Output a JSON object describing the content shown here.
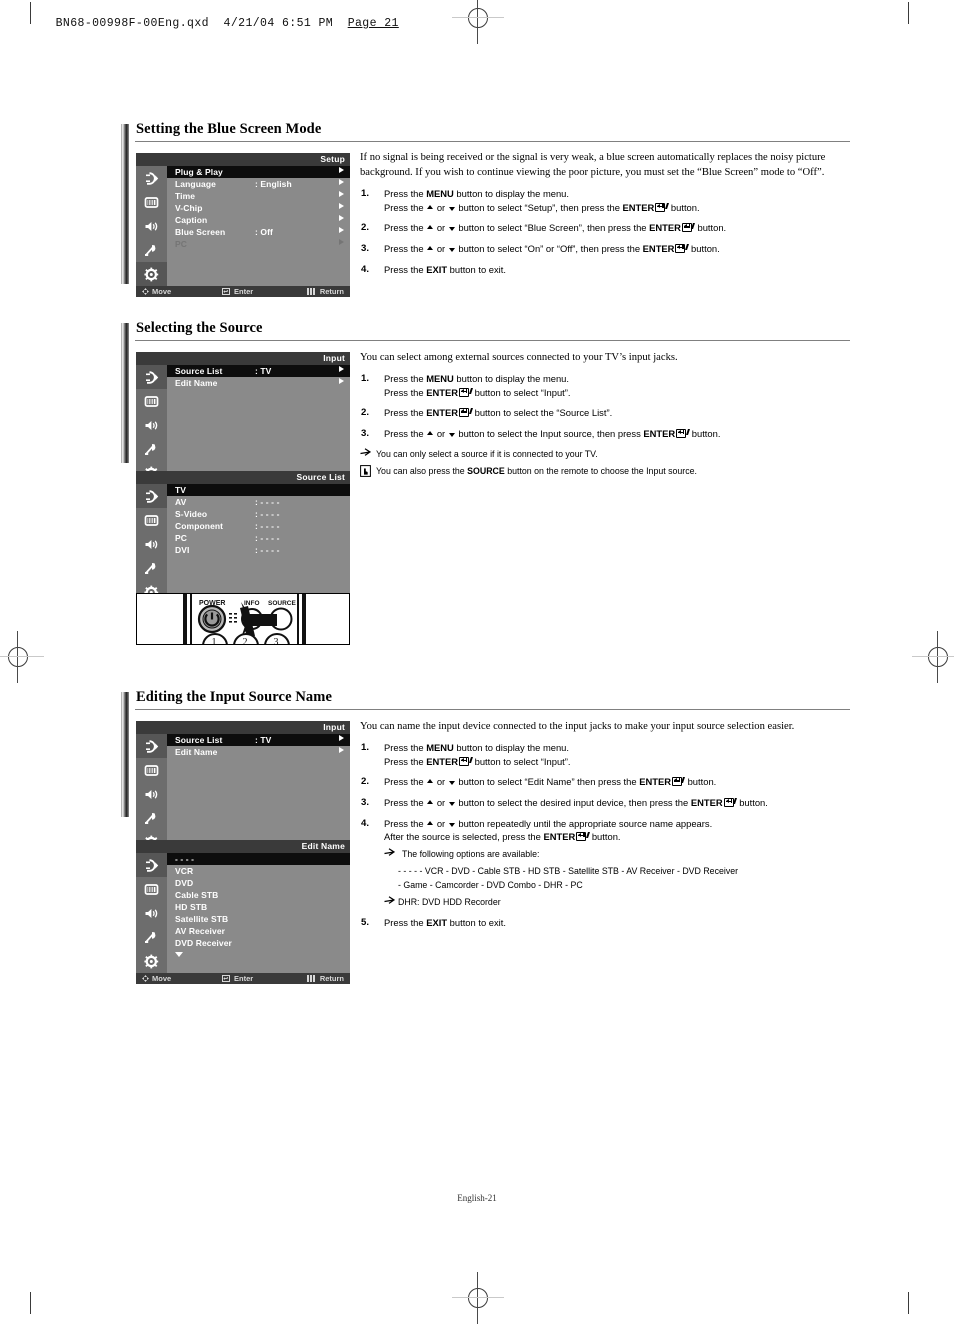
{
  "page_header": {
    "filename": "BN68-00998F-00Eng.qxd",
    "date": "4/21/04",
    "time": "6:51 PM",
    "page_label": "Page 21"
  },
  "footer": {
    "text": "English-21"
  },
  "osd_common": {
    "move_label": "Move",
    "enter_label": "Enter",
    "return_label": "Return",
    "icons": [
      "input-source-icon",
      "picture-icon",
      "sound-icon",
      "channel-antenna-icon",
      "setup-gear-icon"
    ]
  },
  "sections": [
    {
      "id": "blue-screen",
      "title": "Setting the Blue Screen Mode",
      "osd": {
        "header": "Setup",
        "active_icon_index": 4,
        "rows": [
          {
            "name": "Plug & Play",
            "value": "",
            "selected": true,
            "dim": false,
            "arrow": true
          },
          {
            "name": "Language",
            "value": ": English",
            "selected": false,
            "dim": false,
            "arrow": true
          },
          {
            "name": "Time",
            "value": "",
            "selected": false,
            "dim": false,
            "arrow": true
          },
          {
            "name": "V-Chip",
            "value": "",
            "selected": false,
            "dim": false,
            "arrow": true
          },
          {
            "name": "Caption",
            "value": "",
            "selected": false,
            "dim": false,
            "arrow": true
          },
          {
            "name": "Blue Screen",
            "value": ": Off",
            "selected": false,
            "dim": false,
            "arrow": true
          },
          {
            "name": "PC",
            "value": "",
            "selected": false,
            "dim": true,
            "arrow": true
          }
        ],
        "blank_rows": 0,
        "show_more_arrow": false
      },
      "intro": "If no signal is being received or the signal is very weak, a blue screen automatically replaces the noisy picture background. If you wish to continue viewing the poor picture, you must set the “Blue Screen” mode to “Off”.",
      "steps": [
        {
          "num": "1.",
          "lines": [
            {
              "parts": [
                {
                  "t": "Press the "
                },
                {
                  "t": "MENU",
                  "b": true
                },
                {
                  "t": " button to display the menu."
                }
              ]
            },
            {
              "parts": [
                {
                  "t": "Press the "
                },
                {
                  "icon": "up-arrow"
                },
                {
                  "t": " or "
                },
                {
                  "icon": "down-arrow"
                },
                {
                  "t": " button to select “Setup”, then press the "
                },
                {
                  "t": "ENTER",
                  "b": true
                },
                {
                  "icon": "enter-key"
                },
                {
                  "t": " button."
                }
              ]
            }
          ]
        },
        {
          "num": "2.",
          "lines": [
            {
              "parts": [
                {
                  "t": "Press the "
                },
                {
                  "icon": "up-arrow"
                },
                {
                  "t": " or "
                },
                {
                  "icon": "down-arrow"
                },
                {
                  "t": " button to select “Blue Screen”, then press the "
                },
                {
                  "t": "ENTER",
                  "b": true
                },
                {
                  "icon": "enter-key"
                },
                {
                  "t": " button."
                }
              ]
            }
          ]
        },
        {
          "num": "3.",
          "lines": [
            {
              "parts": [
                {
                  "t": "Press the "
                },
                {
                  "icon": "up-arrow"
                },
                {
                  "t": " or "
                },
                {
                  "icon": "down-arrow"
                },
                {
                  "t": " button to select “On” or “Off”, then press the "
                },
                {
                  "t": "ENTER",
                  "b": true
                },
                {
                  "icon": "enter-key"
                },
                {
                  "t": " button."
                }
              ]
            }
          ]
        },
        {
          "num": "4.",
          "lines": [
            {
              "parts": [
                {
                  "t": "Press the "
                },
                {
                  "t": "EXIT",
                  "b": true
                },
                {
                  "t": " button to exit."
                }
              ]
            }
          ]
        }
      ],
      "notes": []
    },
    {
      "id": "selecting-source",
      "title": "Selecting the Source",
      "osd": {
        "header": "Input",
        "active_icon_index": 0,
        "rows": [
          {
            "name": "Source List",
            "value": ": TV",
            "selected": true,
            "dim": false,
            "arrow": true
          },
          {
            "name": "Edit Name",
            "value": "",
            "selected": false,
            "dim": false,
            "arrow": true
          }
        ],
        "blank_rows": 5,
        "show_more_arrow": false
      },
      "osd2": {
        "header": "Source List",
        "active_icon_index": 0,
        "rows": [
          {
            "name": "TV",
            "value": "",
            "selected": true,
            "dim": false,
            "arrow": false
          },
          {
            "name": "AV",
            "value": ": - - - -",
            "selected": false,
            "dim": false,
            "arrow": false
          },
          {
            "name": "S-Video",
            "value": ": - - - -",
            "selected": false,
            "dim": false,
            "arrow": false
          },
          {
            "name": "Component",
            "value": ": - - - -",
            "selected": false,
            "dim": false,
            "arrow": false
          },
          {
            "name": "PC",
            "value": ": - - - -",
            "selected": false,
            "dim": false,
            "arrow": false
          },
          {
            "name": "DVI",
            "value": ": - - - -",
            "selected": false,
            "dim": false,
            "arrow": false
          }
        ],
        "blank_rows": 1,
        "show_more_arrow": false
      },
      "remote": {
        "power_label": "POWER",
        "info_label": "INFO",
        "source_label": "SOURCE",
        "buttons": [
          "1",
          "2",
          "3"
        ]
      },
      "intro": "You can select among external sources connected to your TV’s input jacks.",
      "steps": [
        {
          "num": "1.",
          "lines": [
            {
              "parts": [
                {
                  "t": "Press the "
                },
                {
                  "t": "MENU",
                  "b": true
                },
                {
                  "t": " button to display the menu."
                }
              ]
            },
            {
              "parts": [
                {
                  "t": "Press the "
                },
                {
                  "t": "ENTER",
                  "b": true
                },
                {
                  "icon": "enter-key"
                },
                {
                  "t": " button to select “Input”."
                }
              ]
            }
          ]
        },
        {
          "num": "2.",
          "lines": [
            {
              "parts": [
                {
                  "t": "Press the "
                },
                {
                  "t": "ENTER",
                  "b": true
                },
                {
                  "icon": "enter-key"
                },
                {
                  "t": " button to select the “Source List”."
                }
              ]
            }
          ]
        },
        {
          "num": "3.",
          "lines": [
            {
              "parts": [
                {
                  "t": "Press the "
                },
                {
                  "icon": "up-arrow"
                },
                {
                  "t": " or "
                },
                {
                  "icon": "down-arrow"
                },
                {
                  "t": " button to select the Input source, then press "
                },
                {
                  "t": "ENTER",
                  "b": true
                },
                {
                  "icon": "enter-key"
                },
                {
                  "t": " button."
                }
              ]
            }
          ]
        }
      ],
      "notes": [
        {
          "glyph": "note-arrow-icon",
          "parts": [
            {
              "t": "You can only select a source if it is connected to your TV."
            }
          ]
        },
        {
          "glyph": "remote-hand-icon",
          "parts": [
            {
              "t": "You can also press the "
            },
            {
              "t": "SOURCE",
              "b": true
            },
            {
              "t": " button on the remote to choose the Input source."
            }
          ]
        }
      ]
    },
    {
      "id": "editing-input-source-name",
      "title": "Editing the Input Source Name",
      "osd": {
        "header": "Input",
        "active_icon_index": 0,
        "rows": [
          {
            "name": "Source List",
            "value": ": TV",
            "selected": true,
            "dim": false,
            "arrow": true
          },
          {
            "name": "Edit Name",
            "value": "",
            "selected": false,
            "dim": false,
            "arrow": true
          }
        ],
        "blank_rows": 5,
        "show_more_arrow": false
      },
      "osd2": {
        "header": "Edit Name",
        "active_icon_index": 0,
        "rows": [
          {
            "name": "- - - -",
            "value": "",
            "selected": true,
            "dim": false,
            "arrow": false
          },
          {
            "name": "VCR",
            "value": "",
            "selected": false,
            "dim": false,
            "arrow": false
          },
          {
            "name": "DVD",
            "value": "",
            "selected": false,
            "dim": false,
            "arrow": false
          },
          {
            "name": "Cable STB",
            "value": "",
            "selected": false,
            "dim": false,
            "arrow": false
          },
          {
            "name": "HD STB",
            "value": "",
            "selected": false,
            "dim": false,
            "arrow": false
          },
          {
            "name": "Satellite STB",
            "value": "",
            "selected": false,
            "dim": false,
            "arrow": false
          },
          {
            "name": "AV Receiver",
            "value": "",
            "selected": false,
            "dim": false,
            "arrow": false
          },
          {
            "name": "DVD Receiver",
            "value": "",
            "selected": false,
            "dim": false,
            "arrow": false
          }
        ],
        "blank_rows": 0,
        "show_more_arrow": true
      },
      "intro": "You can name the input device connected to the input jacks to make your input source selection easier.",
      "steps": [
        {
          "num": "1.",
          "lines": [
            {
              "parts": [
                {
                  "t": "Press the "
                },
                {
                  "t": "MENU",
                  "b": true
                },
                {
                  "t": " button to display the menu."
                }
              ]
            },
            {
              "parts": [
                {
                  "t": "Press the "
                },
                {
                  "t": "ENTER",
                  "b": true
                },
                {
                  "icon": "enter-key"
                },
                {
                  "t": " button to select “Input”."
                }
              ]
            }
          ]
        },
        {
          "num": "2.",
          "lines": [
            {
              "parts": [
                {
                  "t": "Press the "
                },
                {
                  "icon": "up-arrow"
                },
                {
                  "t": " or "
                },
                {
                  "icon": "down-arrow"
                },
                {
                  "t": " button to select “Edit Name” then press the "
                },
                {
                  "t": "ENTER",
                  "b": true
                },
                {
                  "icon": "enter-key"
                },
                {
                  "t": " button."
                }
              ]
            }
          ]
        },
        {
          "num": "3.",
          "lines": [
            {
              "parts": [
                {
                  "t": "Press the "
                },
                {
                  "icon": "up-arrow"
                },
                {
                  "t": " or "
                },
                {
                  "icon": "down-arrow"
                },
                {
                  "t": " button to select the desired input device, then press the "
                },
                {
                  "t": "ENTER",
                  "b": true
                },
                {
                  "icon": "enter-key"
                },
                {
                  "t": " button."
                }
              ]
            }
          ]
        },
        {
          "num": "4.",
          "lines": [
            {
              "parts": [
                {
                  "t": "Press the "
                },
                {
                  "icon": "up-arrow"
                },
                {
                  "t": " or "
                },
                {
                  "icon": "down-arrow"
                },
                {
                  "t": " button repeatedly until the appropriate source name appears."
                }
              ]
            },
            {
              "parts": [
                {
                  "t": "After the source is selected, press the "
                },
                {
                  "t": "ENTER",
                  "b": true
                },
                {
                  "icon": "enter-key"
                },
                {
                  "t": " button."
                }
              ]
            }
          ]
        },
        {
          "num": "5.",
          "lines": [
            {
              "parts": [
                {
                  "t": "Press the "
                },
                {
                  "t": "EXIT",
                  "b": true
                },
                {
                  "t": " button to exit."
                }
              ]
            }
          ]
        }
      ],
      "substep_notes": [
        {
          "glyph": "note-arrow-icon",
          "text": "The following options are available:"
        }
      ],
      "option_lines": [
        "- - - -  - VCR - DVD - Cable STB - HD STB - Satellite STB - AV Receiver - DVD Receiver",
        "- Game - Camcorder - DVD Combo - DHR - PC"
      ],
      "abbrev_note": {
        "glyph": "note-arrow-icon",
        "text": "DHR: DVD HDD Recorder"
      }
    }
  ]
}
